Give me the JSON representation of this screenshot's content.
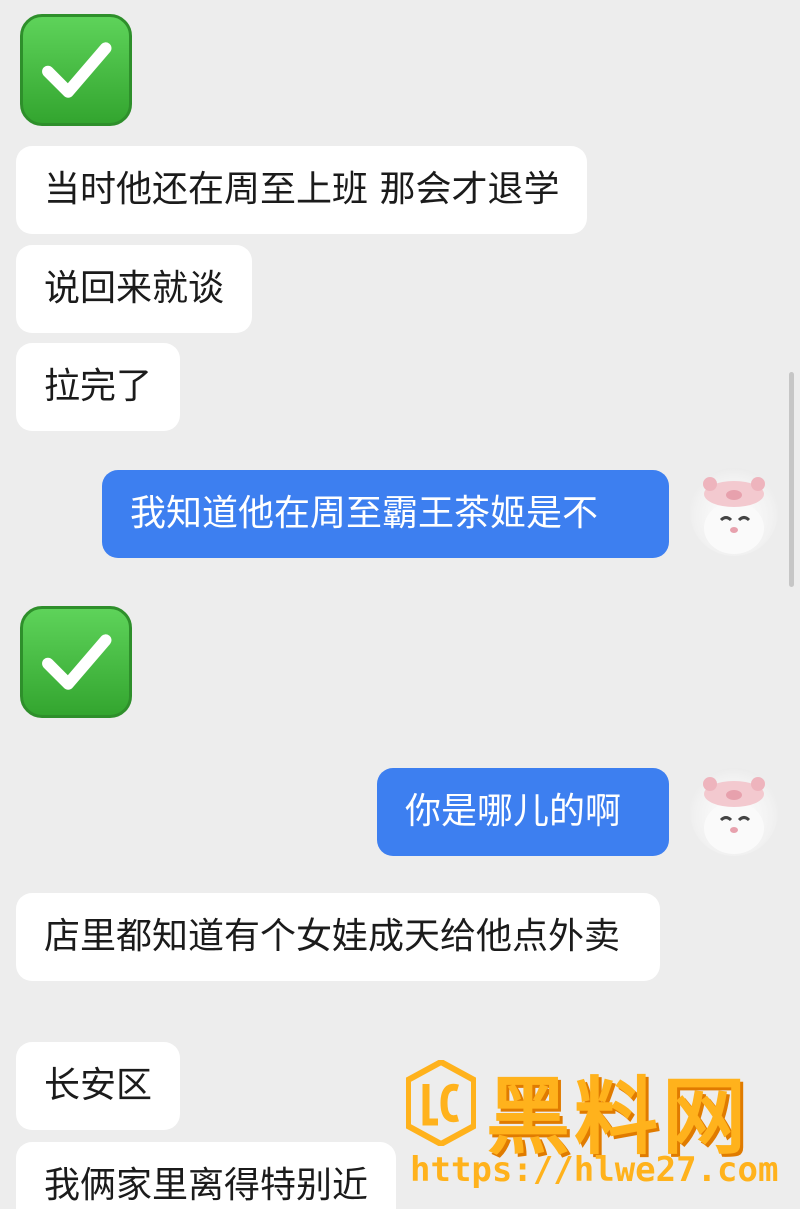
{
  "messages": [
    {
      "text": "当时他还在周至上班 那会才退学"
    },
    {
      "text": "说回来就谈"
    },
    {
      "text": "拉完了"
    },
    {
      "text": "我知道他在周至霸王茶姬是不"
    },
    {
      "text": "你是哪儿的啊"
    },
    {
      "text": "店里都知道有个女娃成天给他点外卖"
    },
    {
      "text": "长安区"
    },
    {
      "text": "我俩家里离得特别近"
    }
  ],
  "icons": {
    "check": "check-mark-emoji",
    "avatar": "pig-mask-plush-avatar"
  },
  "watermark": {
    "title": "黑料网",
    "url": "https://hlwe27.com"
  },
  "colors": {
    "background": "#ededed",
    "incoming_bubble": "#ffffff",
    "outgoing_bubble": "#3d7ff0",
    "check_green": "#3cb83a",
    "watermark": "#ffb21c"
  }
}
